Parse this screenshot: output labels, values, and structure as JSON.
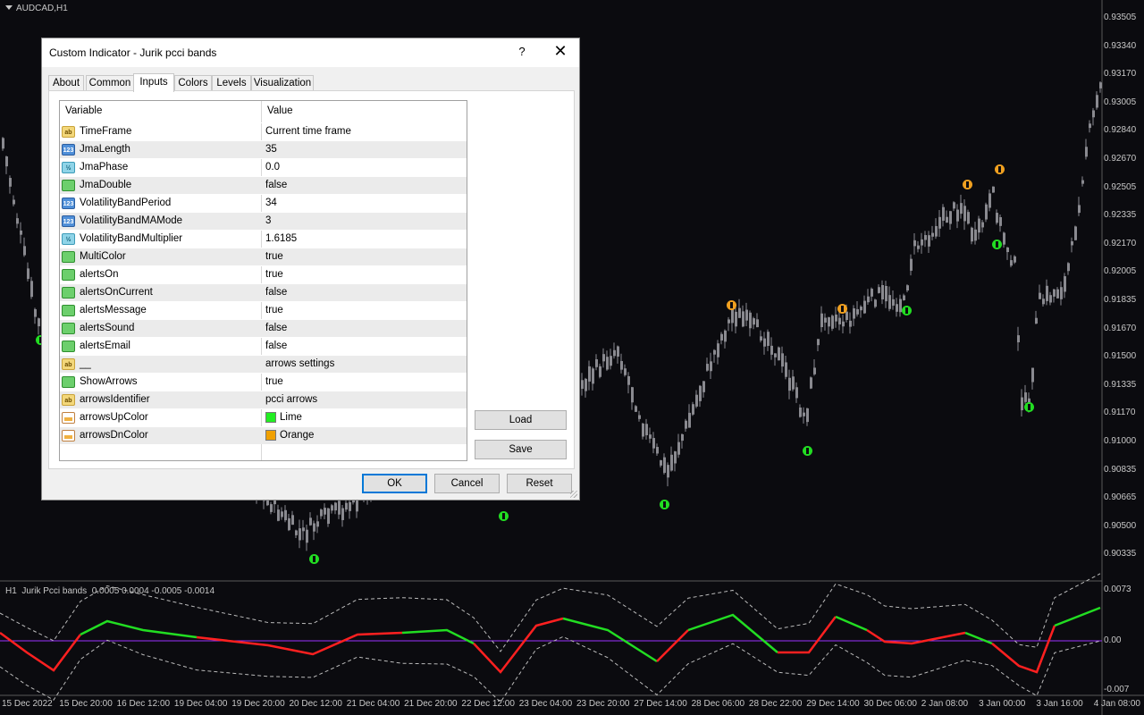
{
  "chart": {
    "symbol_title": "AUDCAD,H1",
    "price_labels": [
      "0.93505",
      "0.93340",
      "0.93170",
      "0.93005",
      "0.92840",
      "0.92670",
      "0.92505",
      "0.92335",
      "0.92170",
      "0.92005",
      "0.91835",
      "0.91670",
      "0.91500",
      "0.91335",
      "0.91170",
      "0.91000",
      "0.90835",
      "0.90665",
      "0.90500",
      "0.90335"
    ],
    "indicator_title": "H1  Jurik Pcci bands  0.0005 0.0004 -0.0005 -0.0014",
    "indicator_scale": [
      "0.0073",
      "0.00",
      "-0.007"
    ],
    "time_labels": [
      "15 Dec 2022",
      "15 Dec 20:00",
      "16 Dec 12:00",
      "19 Dec 04:00",
      "19 Dec 20:00",
      "20 Dec 12:00",
      "21 Dec 04:00",
      "21 Dec 20:00",
      "22 Dec 12:00",
      "23 Dec 04:00",
      "23 Dec 20:00",
      "27 Dec 14:00",
      "28 Dec 06:00",
      "28 Dec 22:00",
      "29 Dec 14:00",
      "30 Dec 06:00",
      "2 Jan 08:00",
      "3 Jan 00:00",
      "3 Jan 16:00",
      "4 Jan 08:00"
    ],
    "colors": {
      "background": "#0b0b0f",
      "candle": "#8a8a90",
      "up_arrow": "#22dd22",
      "down_arrow": "#f0a020",
      "zero_line": "#9b30ff",
      "band": "#bbbbbb"
    }
  },
  "dialog": {
    "title": "Custom Indicator - Jurik  pcci bands",
    "help_label": "?",
    "close_label": "✕",
    "tabs": [
      {
        "label": "About"
      },
      {
        "label": "Common"
      },
      {
        "label": "Inputs",
        "active": true
      },
      {
        "label": "Colors"
      },
      {
        "label": "Levels"
      },
      {
        "label": "Visualization"
      }
    ],
    "grid": {
      "header_variable": "Variable",
      "header_value": "Value",
      "rows": [
        {
          "icon": "ab",
          "name": "TimeFrame",
          "value": "Current time frame"
        },
        {
          "icon": "123",
          "name": "JmaLength",
          "value": "35"
        },
        {
          "icon": "half",
          "name": "JmaPhase",
          "value": "0.0"
        },
        {
          "icon": "bool",
          "name": "JmaDouble",
          "value": "false"
        },
        {
          "icon": "123",
          "name": "VolatilityBandPeriod",
          "value": "34"
        },
        {
          "icon": "123",
          "name": "VolatilityBandMAMode",
          "value": "3"
        },
        {
          "icon": "half",
          "name": "VolatilityBandMultiplier",
          "value": "1.6185"
        },
        {
          "icon": "bool",
          "name": "MultiColor",
          "value": "true"
        },
        {
          "icon": "bool",
          "name": "alertsOn",
          "value": "true"
        },
        {
          "icon": "bool",
          "name": "alertsOnCurrent",
          "value": "false"
        },
        {
          "icon": "bool",
          "name": "alertsMessage",
          "value": "true"
        },
        {
          "icon": "bool",
          "name": "alertsSound",
          "value": "false"
        },
        {
          "icon": "bool",
          "name": "alertsEmail",
          "value": "false"
        },
        {
          "icon": "ab",
          "name": "__",
          "value": "arrows settings"
        },
        {
          "icon": "bool",
          "name": "ShowArrows",
          "value": "true"
        },
        {
          "icon": "ab",
          "name": "arrowsIdentifier",
          "value": "pcci arrows"
        },
        {
          "icon": "color",
          "name": "arrowsUpColor",
          "value": "Lime",
          "swatch": "#22ee22"
        },
        {
          "icon": "color",
          "name": "arrowsDnColor",
          "value": "Orange",
          "swatch": "#f0a000"
        }
      ]
    },
    "buttons": {
      "load": "Load",
      "save": "Save",
      "ok": "OK",
      "cancel": "Cancel",
      "reset": "Reset"
    }
  }
}
